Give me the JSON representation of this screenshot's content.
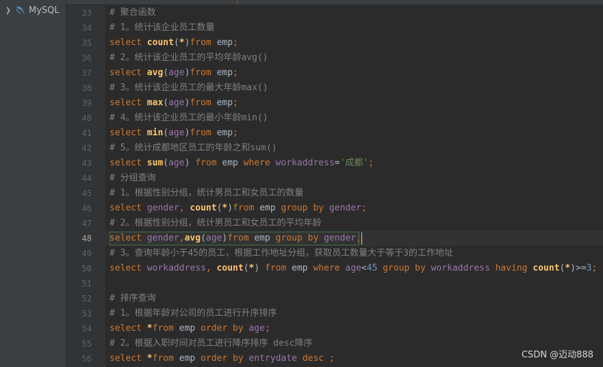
{
  "sidebar": {
    "items": [
      {
        "label": "MySQL",
        "icon": "chevron-right-icon",
        "type_icon": "mysql-dolphin-icon"
      }
    ]
  },
  "editor": {
    "caret_line": 48,
    "lines": [
      {
        "num": "33",
        "tokens": [
          {
            "t": "# 聚合函数",
            "c": "comment"
          }
        ]
      },
      {
        "num": "34",
        "tokens": [
          {
            "t": "# 1。统计该企业员工数量",
            "c": "comment"
          }
        ]
      },
      {
        "num": "35",
        "tokens": [
          {
            "t": "select ",
            "c": "kw"
          },
          {
            "t": "count",
            "c": "fn"
          },
          {
            "t": "(",
            "c": "plain"
          },
          {
            "t": "*",
            "c": "fn"
          },
          {
            "t": ")",
            "c": "plain"
          },
          {
            "t": "from ",
            "c": "kw"
          },
          {
            "t": "emp",
            "c": "plain"
          },
          {
            "t": ";",
            "c": "kw"
          }
        ]
      },
      {
        "num": "36",
        "tokens": [
          {
            "t": "# 2。统计该企业员工的平均年龄avg()",
            "c": "comment"
          }
        ]
      },
      {
        "num": "37",
        "tokens": [
          {
            "t": "select ",
            "c": "kw"
          },
          {
            "t": "avg",
            "c": "fn"
          },
          {
            "t": "(",
            "c": "plain"
          },
          {
            "t": "age",
            "c": "col"
          },
          {
            "t": ")",
            "c": "plain"
          },
          {
            "t": "from ",
            "c": "kw"
          },
          {
            "t": "emp",
            "c": "plain"
          },
          {
            "t": ";",
            "c": "kw"
          }
        ]
      },
      {
        "num": "38",
        "tokens": [
          {
            "t": "# 3。统计该企业员工的最大年龄max()",
            "c": "comment"
          }
        ]
      },
      {
        "num": "39",
        "tokens": [
          {
            "t": "select ",
            "c": "kw"
          },
          {
            "t": "max",
            "c": "fn"
          },
          {
            "t": "(",
            "c": "plain"
          },
          {
            "t": "age",
            "c": "col"
          },
          {
            "t": ")",
            "c": "plain"
          },
          {
            "t": "from ",
            "c": "kw"
          },
          {
            "t": "emp",
            "c": "plain"
          },
          {
            "t": ";",
            "c": "kw"
          }
        ]
      },
      {
        "num": "40",
        "tokens": [
          {
            "t": "# 4。统计该企业员工的最小年龄min()",
            "c": "comment"
          }
        ]
      },
      {
        "num": "41",
        "tokens": [
          {
            "t": "select ",
            "c": "kw"
          },
          {
            "t": "min",
            "c": "fn"
          },
          {
            "t": "(",
            "c": "plain"
          },
          {
            "t": "age",
            "c": "col"
          },
          {
            "t": ")",
            "c": "plain"
          },
          {
            "t": "from ",
            "c": "kw"
          },
          {
            "t": "emp",
            "c": "plain"
          },
          {
            "t": ";",
            "c": "kw"
          }
        ]
      },
      {
        "num": "42",
        "tokens": [
          {
            "t": "# 5。统计成都地区员工的年龄之和sum()",
            "c": "comment"
          }
        ]
      },
      {
        "num": "43",
        "tokens": [
          {
            "t": "select ",
            "c": "kw"
          },
          {
            "t": "sum",
            "c": "fn"
          },
          {
            "t": "(",
            "c": "plain"
          },
          {
            "t": "age",
            "c": "col"
          },
          {
            "t": ") ",
            "c": "plain"
          },
          {
            "t": "from ",
            "c": "kw"
          },
          {
            "t": "emp ",
            "c": "plain"
          },
          {
            "t": "where ",
            "c": "kw"
          },
          {
            "t": "workaddress",
            "c": "col"
          },
          {
            "t": "=",
            "c": "plain"
          },
          {
            "t": "'成都'",
            "c": "str"
          },
          {
            "t": ";",
            "c": "kw"
          }
        ]
      },
      {
        "num": "44",
        "tokens": [
          {
            "t": "# 分组查询",
            "c": "comment"
          }
        ]
      },
      {
        "num": "45",
        "tokens": [
          {
            "t": "# 1。根据性别分组，统计男员工和女员工的数量",
            "c": "comment"
          }
        ]
      },
      {
        "num": "46",
        "tokens": [
          {
            "t": "select ",
            "c": "kw"
          },
          {
            "t": "gender",
            "c": "col"
          },
          {
            "t": ", ",
            "c": "kw"
          },
          {
            "t": "count",
            "c": "fn"
          },
          {
            "t": "(",
            "c": "plain"
          },
          {
            "t": "*",
            "c": "fn"
          },
          {
            "t": ")",
            "c": "plain"
          },
          {
            "t": "from ",
            "c": "kw"
          },
          {
            "t": "emp ",
            "c": "plain"
          },
          {
            "t": "group by ",
            "c": "kw"
          },
          {
            "t": "gender",
            "c": "col"
          },
          {
            "t": ";",
            "c": "kw"
          }
        ]
      },
      {
        "num": "47",
        "tokens": [
          {
            "t": "# 2。根据性别分组，统计男员工和女员工的平均年龄",
            "c": "comment"
          }
        ]
      },
      {
        "num": "48",
        "tokens": [
          {
            "t": "select ",
            "c": "kw"
          },
          {
            "t": "gender",
            "c": "col"
          },
          {
            "t": ",",
            "c": "kw"
          },
          {
            "t": "avg",
            "c": "fn"
          },
          {
            "t": "(",
            "c": "plain"
          },
          {
            "t": "age",
            "c": "col"
          },
          {
            "t": ")",
            "c": "plain"
          },
          {
            "t": "from ",
            "c": "kw"
          },
          {
            "t": "emp ",
            "c": "plain"
          },
          {
            "t": "group by ",
            "c": "kw"
          },
          {
            "t": "gender",
            "c": "col"
          },
          {
            "t": ";",
            "c": "kw"
          }
        ]
      },
      {
        "num": "49",
        "tokens": [
          {
            "t": "# 3。查询年龄小于45的员工，根据工作地址分组，获取员工数量大于等于3的工作地址",
            "c": "comment"
          }
        ]
      },
      {
        "num": "50",
        "tokens": [
          {
            "t": "select ",
            "c": "kw"
          },
          {
            "t": "workaddress",
            "c": "col"
          },
          {
            "t": ", ",
            "c": "kw"
          },
          {
            "t": "count",
            "c": "fn"
          },
          {
            "t": "(",
            "c": "plain"
          },
          {
            "t": "*",
            "c": "fn"
          },
          {
            "t": ") ",
            "c": "plain"
          },
          {
            "t": "from ",
            "c": "kw"
          },
          {
            "t": "emp ",
            "c": "plain"
          },
          {
            "t": "where ",
            "c": "kw"
          },
          {
            "t": "age",
            "c": "col"
          },
          {
            "t": "<",
            "c": "plain"
          },
          {
            "t": "45 ",
            "c": "num"
          },
          {
            "t": "group by ",
            "c": "kw"
          },
          {
            "t": "workaddress ",
            "c": "col"
          },
          {
            "t": "having ",
            "c": "kw"
          },
          {
            "t": "count",
            "c": "fn"
          },
          {
            "t": "(",
            "c": "plain"
          },
          {
            "t": "*",
            "c": "fn"
          },
          {
            "t": ")>=",
            "c": "plain"
          },
          {
            "t": "3",
            "c": "num"
          },
          {
            "t": ";",
            "c": "kw"
          }
        ]
      },
      {
        "num": "51",
        "tokens": []
      },
      {
        "num": "52",
        "tokens": [
          {
            "t": "# 排序查询",
            "c": "comment"
          }
        ]
      },
      {
        "num": "53",
        "tokens": [
          {
            "t": "# 1。根据年龄对公司的员工进行升序排序",
            "c": "comment"
          }
        ]
      },
      {
        "num": "54",
        "tokens": [
          {
            "t": "select ",
            "c": "kw"
          },
          {
            "t": "*",
            "c": "fn"
          },
          {
            "t": "from ",
            "c": "kw"
          },
          {
            "t": "emp ",
            "c": "plain"
          },
          {
            "t": "order by ",
            "c": "kw"
          },
          {
            "t": "age",
            "c": "col"
          },
          {
            "t": ";",
            "c": "kw"
          }
        ]
      },
      {
        "num": "55",
        "tokens": [
          {
            "t": "# 2。根据入职时间对员工进行降序排序 desc降序",
            "c": "comment"
          }
        ]
      },
      {
        "num": "56",
        "tokens": [
          {
            "t": "select ",
            "c": "kw"
          },
          {
            "t": "*",
            "c": "fn"
          },
          {
            "t": "from ",
            "c": "kw"
          },
          {
            "t": "emp ",
            "c": "plain"
          },
          {
            "t": "order by ",
            "c": "kw"
          },
          {
            "t": "entrydate ",
            "c": "col"
          },
          {
            "t": "desc ",
            "c": "kw"
          },
          {
            "t": ";",
            "c": "kw"
          }
        ]
      }
    ]
  },
  "watermark": {
    "text": "CSDN @迈动888"
  },
  "colors": {
    "background": "#2b2b2b",
    "gutter": "#313335",
    "comment": "#808080",
    "kw": "#cc7832",
    "fn": "#ffc66d",
    "col": "#9876aa",
    "str": "#6a8759",
    "num": "#6897bb",
    "plain": "#a9b7c6",
    "line_number": "#606366",
    "line_number_active": "#a4a3a3"
  }
}
